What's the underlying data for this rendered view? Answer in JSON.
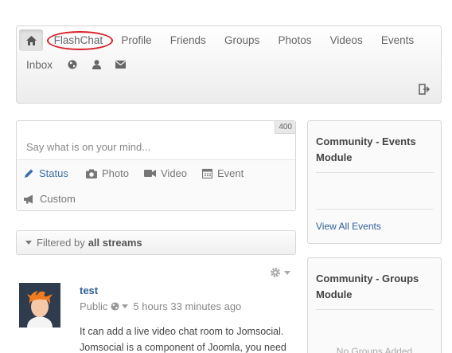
{
  "navbar": {
    "items": [
      "FlashChat",
      "Profile",
      "Friends",
      "Groups",
      "Photos",
      "Videos",
      "Events"
    ],
    "row2_items": [
      "Inbox"
    ]
  },
  "status": {
    "placeholder": "Say what is on your mind...",
    "char_count": "400",
    "tabs": [
      "Status",
      "Photo",
      "Video",
      "Event",
      "Custom"
    ]
  },
  "filter": {
    "prefix": "Filtered by",
    "value": "all streams"
  },
  "post": {
    "author": "test",
    "privacy": "Public",
    "time": "5 hours 33 minutes ago",
    "body": "It can add a live video chat room to Jomsocial. Jomsocial is a component of Joomla, you need"
  },
  "modules": {
    "events": {
      "title": "Community - Events Module",
      "link": "View All Events"
    },
    "groups": {
      "title": "Community - Groups Module",
      "empty": "No Groups Added"
    }
  },
  "colors": {
    "accent": "#3a6ea5",
    "highlight_circle": "#d8232a",
    "avatar_bg": "#2f3c4d"
  }
}
